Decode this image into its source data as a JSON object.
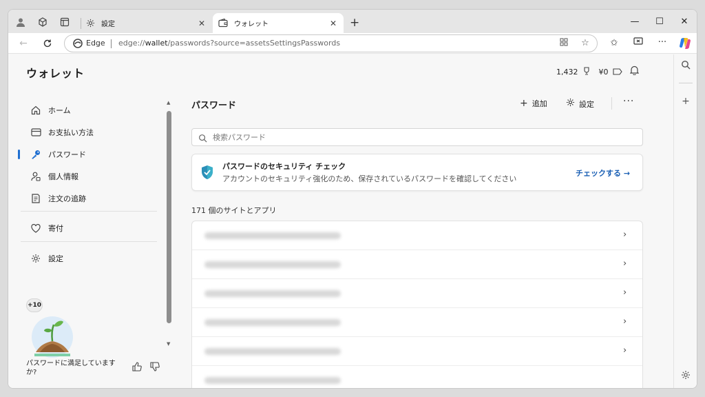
{
  "tabs": [
    {
      "title": "設定",
      "active": false
    },
    {
      "title": "ウォレット",
      "active": true
    }
  ],
  "address": {
    "edge_label": "Edge",
    "url_prefix": "edge://",
    "url_host": "wallet",
    "url_path": "/passwords?source=assetsSettingsPasswords"
  },
  "header": {
    "title": "ウォレット",
    "points": "1,432",
    "cash": "¥0"
  },
  "sidebar": {
    "items": [
      {
        "label": "ホーム",
        "icon": "home-icon"
      },
      {
        "label": "お支払い方法",
        "icon": "card-icon"
      },
      {
        "label": "パスワード",
        "icon": "key-icon",
        "active": true
      },
      {
        "label": "個人情報",
        "icon": "person-icon"
      },
      {
        "label": "注文の追跡",
        "icon": "receipt-icon"
      },
      {
        "label": "寄付",
        "icon": "heart-icon"
      },
      {
        "label": "設定",
        "icon": "gear-icon"
      }
    ],
    "feedback": {
      "badge": "+10",
      "text": "パスワードに満足していますか?"
    }
  },
  "main": {
    "section_title": "パスワード",
    "add_label": "追加",
    "settings_label": "設定",
    "search_placeholder": "検索パスワード",
    "security": {
      "title": "パスワードのセキュリティ チェック",
      "description": "アカウントのセキュリティ強化のため、保存されているパスワードを確認してください",
      "link": "チェックする →"
    },
    "count_label": "171 個のサイトとアプリ",
    "rows": 5
  },
  "colors": {
    "accent": "#1f6fd1",
    "link": "#1a5fb4"
  }
}
